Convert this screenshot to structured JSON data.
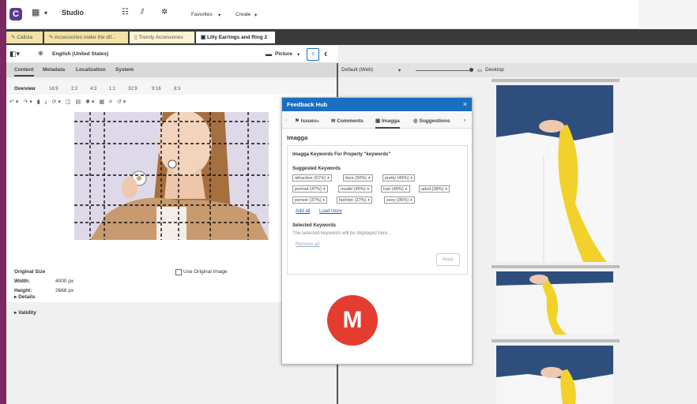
{
  "app": {
    "name": "Studio",
    "favorites_label": "Favorites",
    "create_label": "Create"
  },
  "doc_tabs": [
    {
      "label": "Calista"
    },
    {
      "label": "Accessories make the dif..."
    },
    {
      "label": "Trendy Accessories"
    },
    {
      "label": "Lilly Earrings and Ring 2"
    }
  ],
  "toolbar": {
    "locale": "English (United States)",
    "picture_label": "Picture"
  },
  "subtabs": [
    "Content",
    "Metadata",
    "Localization",
    "System"
  ],
  "ratios": [
    "Overview",
    "16:9",
    "2:2",
    "4:3",
    "1:1",
    "32:9",
    "9:16",
    "8:3"
  ],
  "image_info": {
    "original_size_label": "Original Size",
    "width_label": "Width:",
    "width_value": "4000 px",
    "height_label": "Height:",
    "height_value": "2666 px",
    "use_original_label": "Use Original Image"
  },
  "sections": [
    "Details",
    "Validity"
  ],
  "preview": {
    "device_select": "Default (Web)",
    "device_label": "Desktop"
  },
  "feedback_hub": {
    "title": "Feedback Hub",
    "tabs": [
      "Issues",
      "Comments",
      "Imagga",
      "Suggestions"
    ],
    "section_title": "Imagga",
    "keywords_title": "Imagga Keywords For Property \"keywords\"",
    "suggested_label": "Suggested Keywords",
    "keywords": [
      "attractive (51%)",
      "face (50%)",
      "pretty (49%)",
      "portrait (47%)",
      "model (45%)",
      "hair (40%)",
      "adult (38%)",
      "person (37%)",
      "fashion (37%)",
      "sexy (35%)"
    ],
    "add_all": "Add all",
    "load_more": "Load more",
    "selected_label": "Selected Keywords",
    "selected_hint": "The selected keywords will be displayed here.",
    "remove_all": "Remove all",
    "apply": "Apply"
  },
  "badge_letter": "M",
  "colors": {
    "accent": "#1a6fc0",
    "badge": "#e43d2f",
    "frame": "#7a2a63",
    "scarf": "#f2d22a",
    "denim": "#2e4f7d"
  }
}
